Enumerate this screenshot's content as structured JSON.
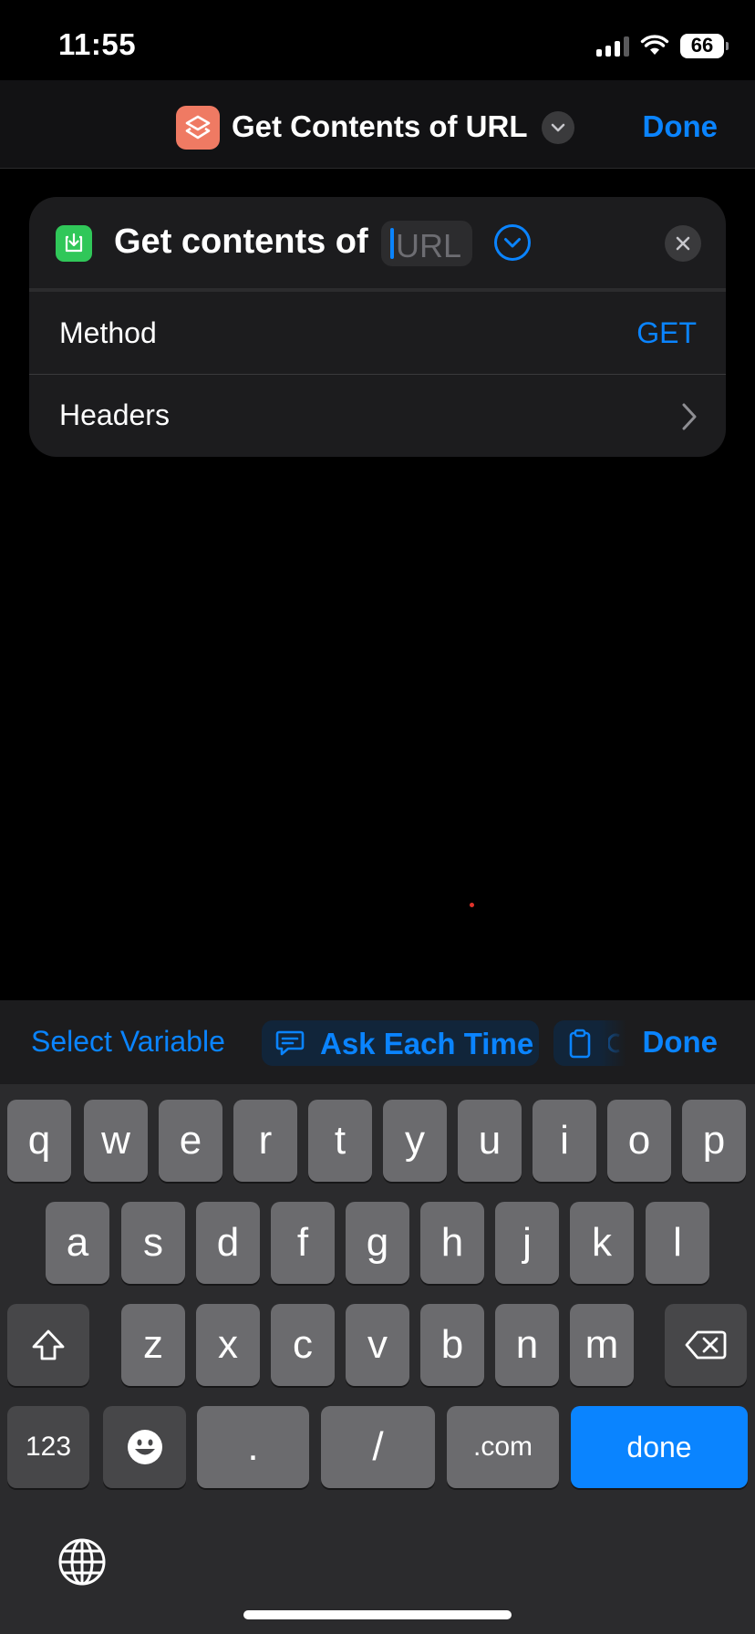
{
  "status_bar": {
    "time": "11:55",
    "battery": "66"
  },
  "nav": {
    "title": "Get Contents of URL",
    "done_label": "Done",
    "app_icon": "shortcuts-layers-icon"
  },
  "action": {
    "prefix": "Get contents of",
    "url_placeholder": "URL",
    "method_label": "Method",
    "method_value": "GET",
    "headers_label": "Headers"
  },
  "accessory_bar": {
    "select_variable": "Select Variable",
    "ask_each_time": "Ask Each Time",
    "done_label": "Done"
  },
  "keyboard": {
    "row1": [
      "q",
      "w",
      "e",
      "r",
      "t",
      "y",
      "u",
      "i",
      "o",
      "p"
    ],
    "row2": [
      "a",
      "s",
      "d",
      "f",
      "g",
      "h",
      "j",
      "k",
      "l"
    ],
    "row3": [
      "z",
      "x",
      "c",
      "v",
      "b",
      "n",
      "m"
    ],
    "numbers_key": "123",
    "period_key": ".",
    "slash_key": "/",
    "dotcom_key": ".com",
    "done_key": "done"
  },
  "colors": {
    "accent": "#0a84ff",
    "app_icon": "#ef7a63",
    "action_icon": "#30c759"
  }
}
